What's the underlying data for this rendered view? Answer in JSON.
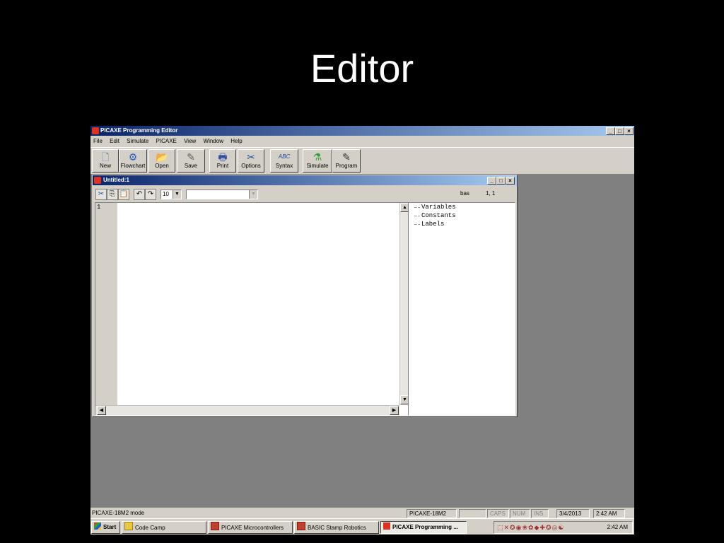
{
  "slide": {
    "title": "Editor"
  },
  "app": {
    "title": "PICAXE Programming Editor",
    "window_buttons": [
      "_",
      "□",
      "×"
    ],
    "menu": [
      "File",
      "Edit",
      "Simulate",
      "PICAXE",
      "View",
      "Window",
      "Help"
    ],
    "toolbar": [
      {
        "label": "New",
        "icon": "new-document-icon",
        "glyph": "🗋"
      },
      {
        "label": "Flowchart",
        "icon": "flowchart-icon",
        "glyph": "⚙"
      },
      {
        "label": "Open",
        "icon": "open-folder-icon",
        "glyph": "📂"
      },
      {
        "label": "Save",
        "icon": "save-pen-icon",
        "glyph": "✎"
      },
      {
        "label": "Print",
        "icon": "printer-icon",
        "glyph": "🖶"
      },
      {
        "label": "Options",
        "icon": "options-tools-icon",
        "glyph": "✂"
      },
      {
        "label": "Syntax",
        "icon": "syntax-check-icon",
        "glyph": "ABC"
      },
      {
        "label": "Simulate",
        "icon": "simulate-icon",
        "glyph": "⚗"
      },
      {
        "label": "Program",
        "icon": "program-icon",
        "glyph": "✎"
      }
    ]
  },
  "editor": {
    "title": "Untitled:1",
    "font_size": "10",
    "font_name": "",
    "language": "bas",
    "cursor_pos": "1, 1",
    "line_numbers": [
      "1"
    ],
    "tree": [
      "Variables",
      "Constants",
      "Labels"
    ]
  },
  "status": {
    "mode": "PICAXE-18M2 mode",
    "chip": "PICAXE-18M2",
    "caps": "CAPS",
    "num": "NUM",
    "ins": "INS",
    "date": "3/4/2013",
    "time": "2:42 AM"
  },
  "taskbar": {
    "start": "Start",
    "items": [
      {
        "label": "Code Camp",
        "icon": "folder-icon"
      },
      {
        "label": "PICAXE Microcontrollers",
        "icon": "powerpoint-icon"
      },
      {
        "label": "BASIC Stamp Robotics",
        "icon": "powerpoint-icon"
      },
      {
        "label": "PICAXE Programming ...",
        "icon": "picaxe-icon"
      }
    ],
    "clock": "2:42 AM"
  }
}
